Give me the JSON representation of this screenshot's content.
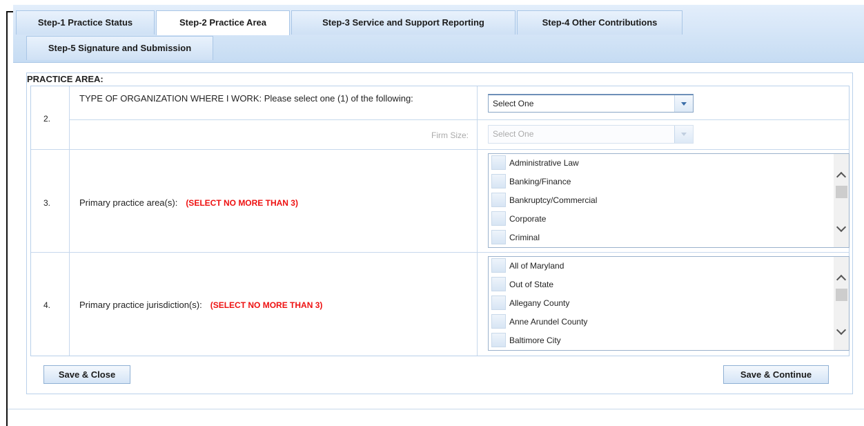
{
  "tabs": {
    "step1": "Step-1 Practice Status",
    "step2": "Step-2 Practice Area",
    "step3": "Step-3 Service and Support Reporting",
    "step4": "Step-4 Other Contributions",
    "step5": "Step-5 Signature and Submission"
  },
  "section_title": "PRACTICE AREA:",
  "q2": {
    "number": "2.",
    "label": "TYPE OF ORGANIZATION WHERE I WORK: Please select one (1) of the following:",
    "select_value": "Select One",
    "firm_size_label": "Firm Size:",
    "firm_size_value": "Select One"
  },
  "q3": {
    "number": "3.",
    "label": "Primary practice area(s):",
    "note": "(SELECT NO MORE THAN 3)",
    "options": [
      "Administrative Law",
      "Banking/Finance",
      "Bankruptcy/Commercial",
      "Corporate",
      "Criminal"
    ]
  },
  "q4": {
    "number": "4.",
    "label": "Primary practice jurisdiction(s):",
    "note": "(SELECT NO MORE THAN 3)",
    "options": [
      "All of Maryland",
      "Out of State",
      "Allegany County",
      "Anne Arundel County",
      "Baltimore City"
    ]
  },
  "footer": {
    "save_close": "Save & Close",
    "save_continue": "Save & Continue"
  },
  "colors": {
    "tab_gradient_top": "#e3eefb",
    "tab_gradient_bottom": "#c6dcf3",
    "required_note": "#ee1111",
    "border": "#b9d0ea"
  }
}
